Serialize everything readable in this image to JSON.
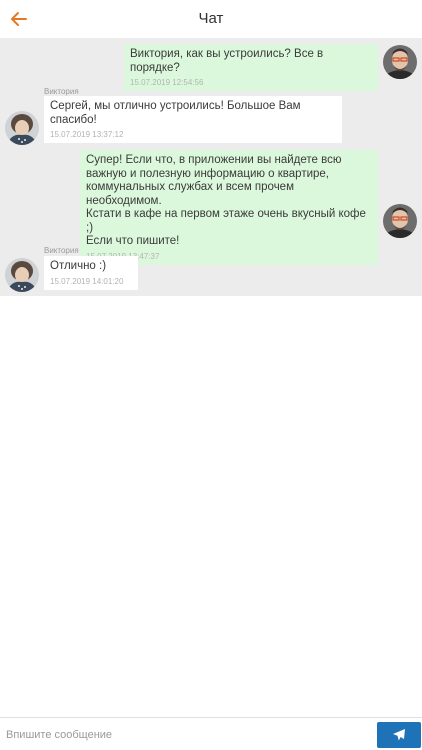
{
  "header": {
    "title": "Чат",
    "back_icon": "arrow-left-icon",
    "accent": "#e87722"
  },
  "messages": [
    {
      "direction": "out",
      "sender": "",
      "text": "Виктория, как вы устроились? Все в порядке?",
      "time": "15.07.2019 12:54:56"
    },
    {
      "direction": "in",
      "sender": "Виктория",
      "text_lines": [
        "Сергей, мы отлично устроились! Большое Вам",
        "спасибо!"
      ],
      "time": "15.07.2019 13:37:12"
    },
    {
      "direction": "out",
      "sender": "",
      "text_lines": [
        "Супер! Если что, в приложении вы найдете всю",
        "важную и полезную информацию о квартире,",
        "коммунальных службах и всем прочем необходимом.",
        "Кстати в кафе на первом этаже очень вкусный кофе ;)",
        "Если что пишите!"
      ],
      "time": "15.07.2019 13:47:37"
    },
    {
      "direction": "in",
      "sender": "Виктория",
      "text": "Отлично :)",
      "time": "15.07.2019 14:01:20"
    }
  ],
  "composer": {
    "placeholder": "Впишите сообщение",
    "send_icon": "paper-plane-icon",
    "send_color": "#1e72b8"
  }
}
